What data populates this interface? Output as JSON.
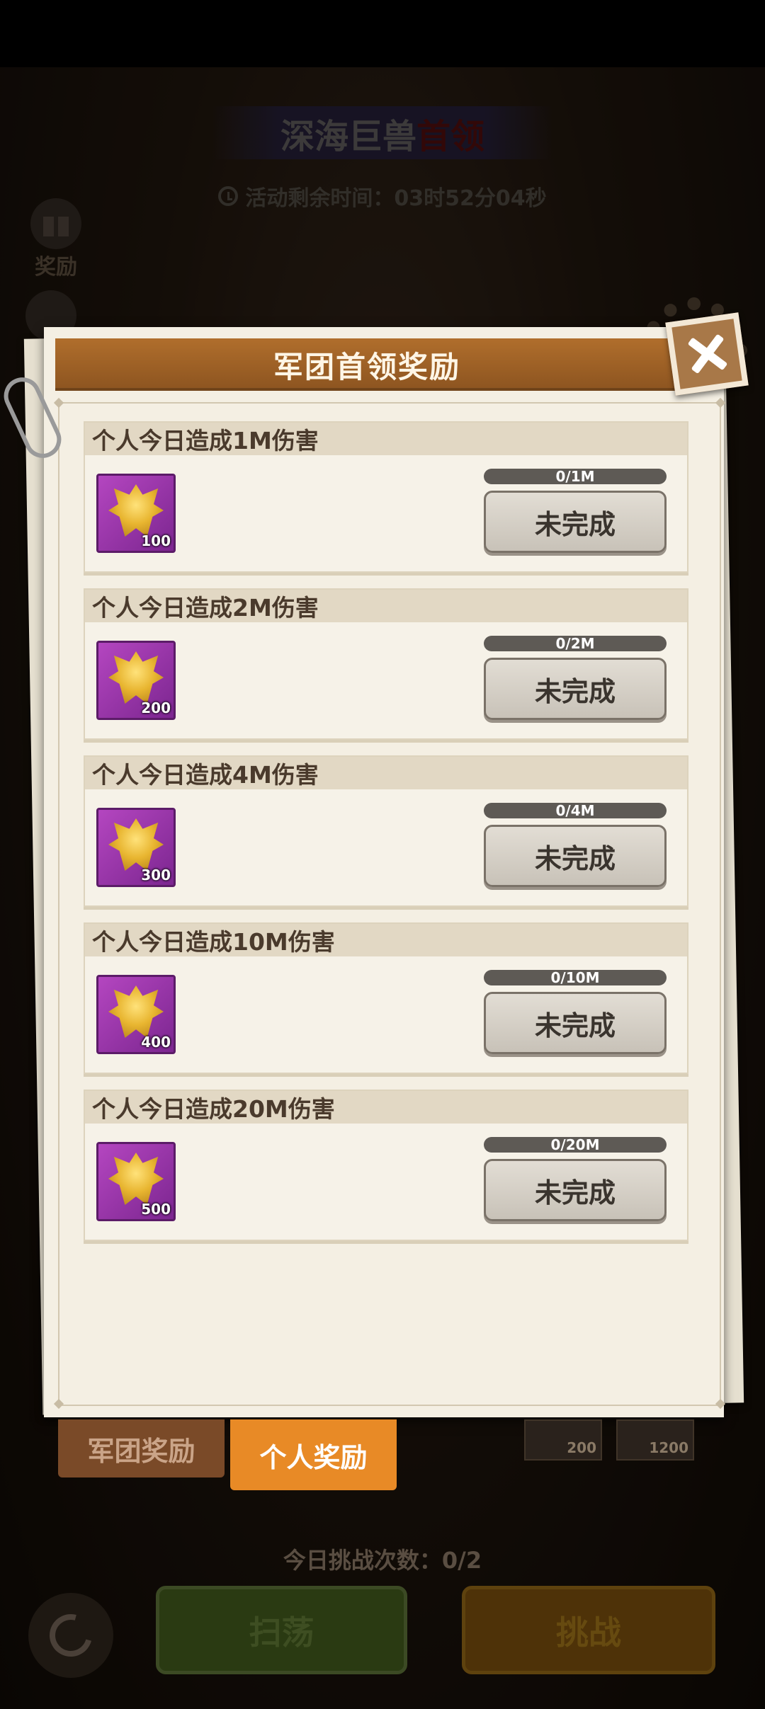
{
  "event": {
    "title": "深海巨兽",
    "title_highlight": "首领",
    "timer": "活动剩余时间：03时52分04秒"
  },
  "side": {
    "reward_label": "奖励"
  },
  "dialog": {
    "title": "军团首领奖励",
    "tasks": [
      {
        "label": "个人今日造成1M伤害",
        "progress_text": "0/1M",
        "progress_fraction": 0,
        "reward_count": "100",
        "status": "未完成"
      },
      {
        "label": "个人今日造成2M伤害",
        "progress_text": "0/2M",
        "progress_fraction": 0,
        "reward_count": "200",
        "status": "未完成"
      },
      {
        "label": "个人今日造成4M伤害",
        "progress_text": "0/4M",
        "progress_fraction": 0,
        "reward_count": "300",
        "status": "未完成"
      },
      {
        "label": "个人今日造成10M伤害",
        "progress_text": "0/10M",
        "progress_fraction": 0,
        "reward_count": "400",
        "status": "未完成"
      },
      {
        "label": "个人今日造成20M伤害",
        "progress_text": "0/20M",
        "progress_fraction": 0,
        "reward_count": "500",
        "status": "未完成"
      }
    ]
  },
  "tabs": {
    "corps": "军团奖励",
    "personal": "个人奖励",
    "right_rewards": [
      "200",
      "1200"
    ]
  },
  "footer": {
    "challenge_count": "今日挑战次数：0/2",
    "sweep": "扫荡",
    "challenge": "挑战"
  },
  "colors": {
    "accent_orange": "#e88a26",
    "title_bar": "#a0622a",
    "reward_purple": "#9b36ab"
  }
}
